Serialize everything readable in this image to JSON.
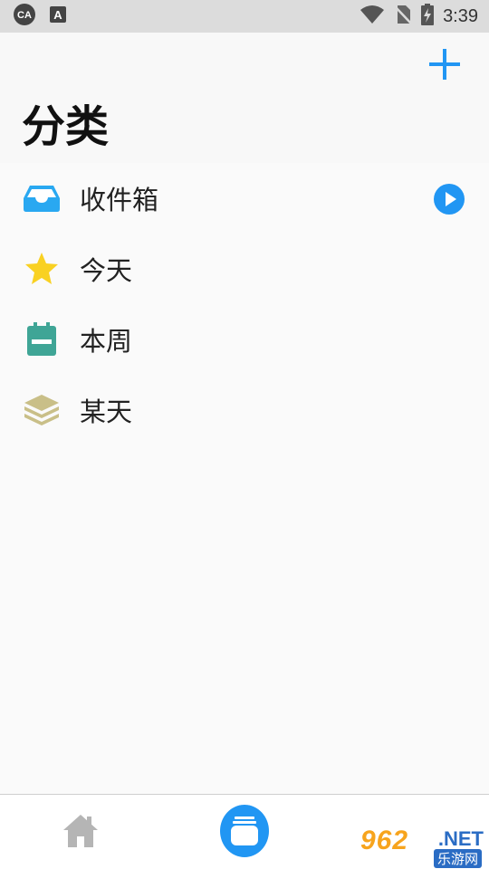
{
  "status_bar": {
    "time": "3:39",
    "left_icons": [
      "cast-icon",
      "text-notification-icon"
    ],
    "right_icons": [
      "wifi-icon",
      "no-sim-icon",
      "battery-charging-icon"
    ]
  },
  "header": {
    "title": "分类",
    "add_icon": "plus-icon",
    "accent_color": "#2196f3"
  },
  "categories": [
    {
      "label": "收件箱",
      "icon": "inbox-icon",
      "icon_color": "#29a8f1",
      "has_action": true
    },
    {
      "label": "今天",
      "icon": "star-icon",
      "icon_color": "#f9d122"
    },
    {
      "label": "本周",
      "icon": "calendar-icon",
      "icon_color": "#3fa596"
    },
    {
      "label": "某天",
      "icon": "layers-icon",
      "icon_color": "#c9bf88"
    }
  ],
  "bottom_nav": {
    "items": [
      {
        "icon": "home-icon",
        "active": false
      },
      {
        "icon": "categories-icon",
        "active": true
      }
    ]
  },
  "watermark": {
    "number": "962",
    "suffix": ".NET",
    "subtext": "乐游网"
  }
}
